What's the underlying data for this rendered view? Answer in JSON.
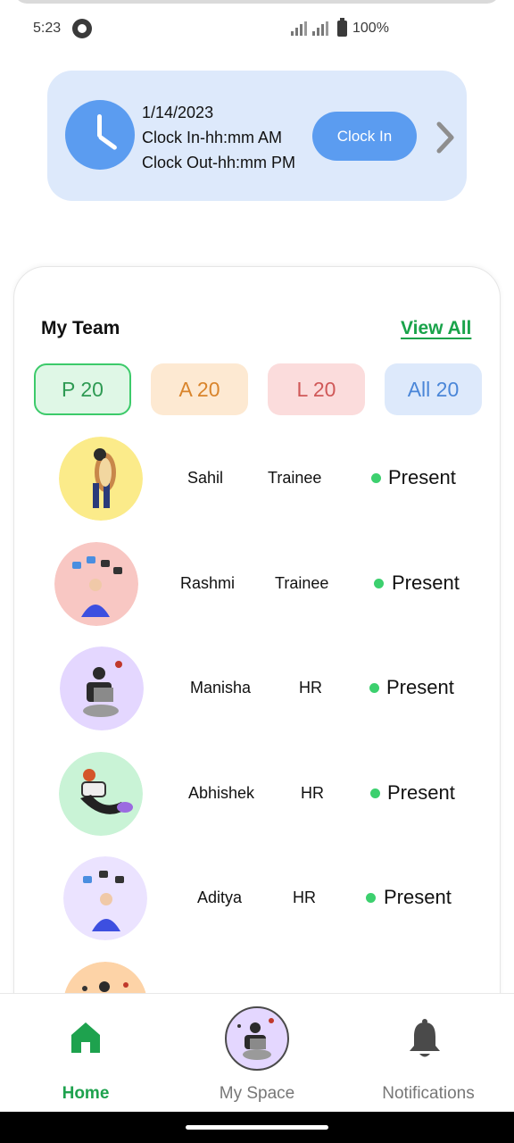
{
  "status_bar": {
    "time": "5:23",
    "battery": "100%"
  },
  "clock_card": {
    "date": "1/14/2023",
    "clock_in": "Clock In-hh:mm AM",
    "clock_out": "Clock Out-hh:mm PM",
    "button_label": "Clock In"
  },
  "team": {
    "title": "My Team",
    "view_all": "View All",
    "chips": {
      "present": "P 20",
      "absent": "A 20",
      "leave": "L 20",
      "all": "All 20"
    },
    "members": [
      {
        "name": "Sahil",
        "role": "Trainee",
        "status": "Present",
        "avatar_bg": "#fbeb8a"
      },
      {
        "name": "Rashmi",
        "role": "Trainee",
        "status": "Present",
        "avatar_bg": "#f8c7c3"
      },
      {
        "name": "Manisha",
        "role": "HR",
        "status": "Present",
        "avatar_bg": "#e4d7ff"
      },
      {
        "name": "Abhishek",
        "role": "HR",
        "status": "Present",
        "avatar_bg": "#c9f3d6"
      },
      {
        "name": "Aditya",
        "role": "HR",
        "status": "Present",
        "avatar_bg": "#ebe3ff"
      }
    ],
    "partial_avatar_bg": "#fdd3a7"
  },
  "bottom_nav": {
    "home": "Home",
    "my_space": "My Space",
    "notifications": "Notifications"
  },
  "colors": {
    "accent_green": "#19a34a",
    "accent_blue": "#5b9cf0",
    "card_blue": "#dde9fb"
  }
}
